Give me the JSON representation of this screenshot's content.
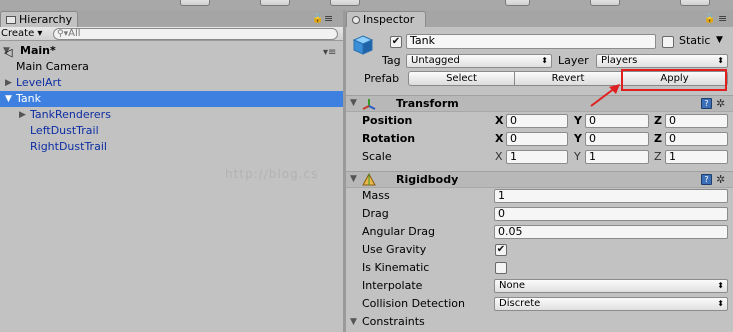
{
  "hierarchy": {
    "tab_label": "Hierarchy",
    "create_label": "Create ▾",
    "search_placeholder": "All",
    "scene_name": "Main*",
    "items": [
      {
        "label": "Main Camera"
      },
      {
        "label": "LevelArt"
      },
      {
        "label": "Tank"
      },
      {
        "label": "TankRenderers"
      },
      {
        "label": "LeftDustTrail"
      },
      {
        "label": "RightDustTrail"
      }
    ]
  },
  "inspector": {
    "tab_label": "Inspector",
    "object_name": "Tank",
    "active_checked": true,
    "static_label": "Static",
    "tag_label": "Tag",
    "tag_value": "Untagged",
    "layer_label": "Layer",
    "layer_value": "Players",
    "prefab_label": "Prefab",
    "prefab_buttons": {
      "select": "Select",
      "revert": "Revert",
      "apply": "Apply"
    },
    "transform": {
      "title": "Transform",
      "rows": [
        {
          "label": "Position",
          "x": "0",
          "y": "0",
          "z": "0"
        },
        {
          "label": "Rotation",
          "x": "0",
          "y": "0",
          "z": "0"
        },
        {
          "label": "Scale",
          "x": "1",
          "y": "1",
          "z": "1"
        }
      ],
      "axis_labels": {
        "x": "X",
        "y": "Y",
        "z": "Z"
      }
    },
    "rigidbody": {
      "title": "Rigidbody",
      "mass_label": "Mass",
      "mass": "1",
      "drag_label": "Drag",
      "drag": "0",
      "angular_drag_label": "Angular Drag",
      "angular_drag": "0.05",
      "use_gravity_label": "Use Gravity",
      "use_gravity": true,
      "is_kinematic_label": "Is Kinematic",
      "is_kinematic": false,
      "interpolate_label": "Interpolate",
      "interpolate": "None",
      "collision_label": "Collision Detection",
      "collision": "Discrete",
      "constraints_label": "Constraints"
    }
  },
  "watermark": "http://blog.cs",
  "colors": {
    "selection": "#3d80df",
    "annotation": "#e02020",
    "prefab_name": "#0d2ea3"
  },
  "icons": {
    "hierarchy_tab": "hierarchy-icon",
    "inspector_tab": "inspector-icon",
    "lock": "lock-icon",
    "object": "cube-icon",
    "transform": "transform-icon",
    "rigidbody": "rigidbody-icon",
    "help": "help-icon",
    "settings": "gear-icon"
  }
}
